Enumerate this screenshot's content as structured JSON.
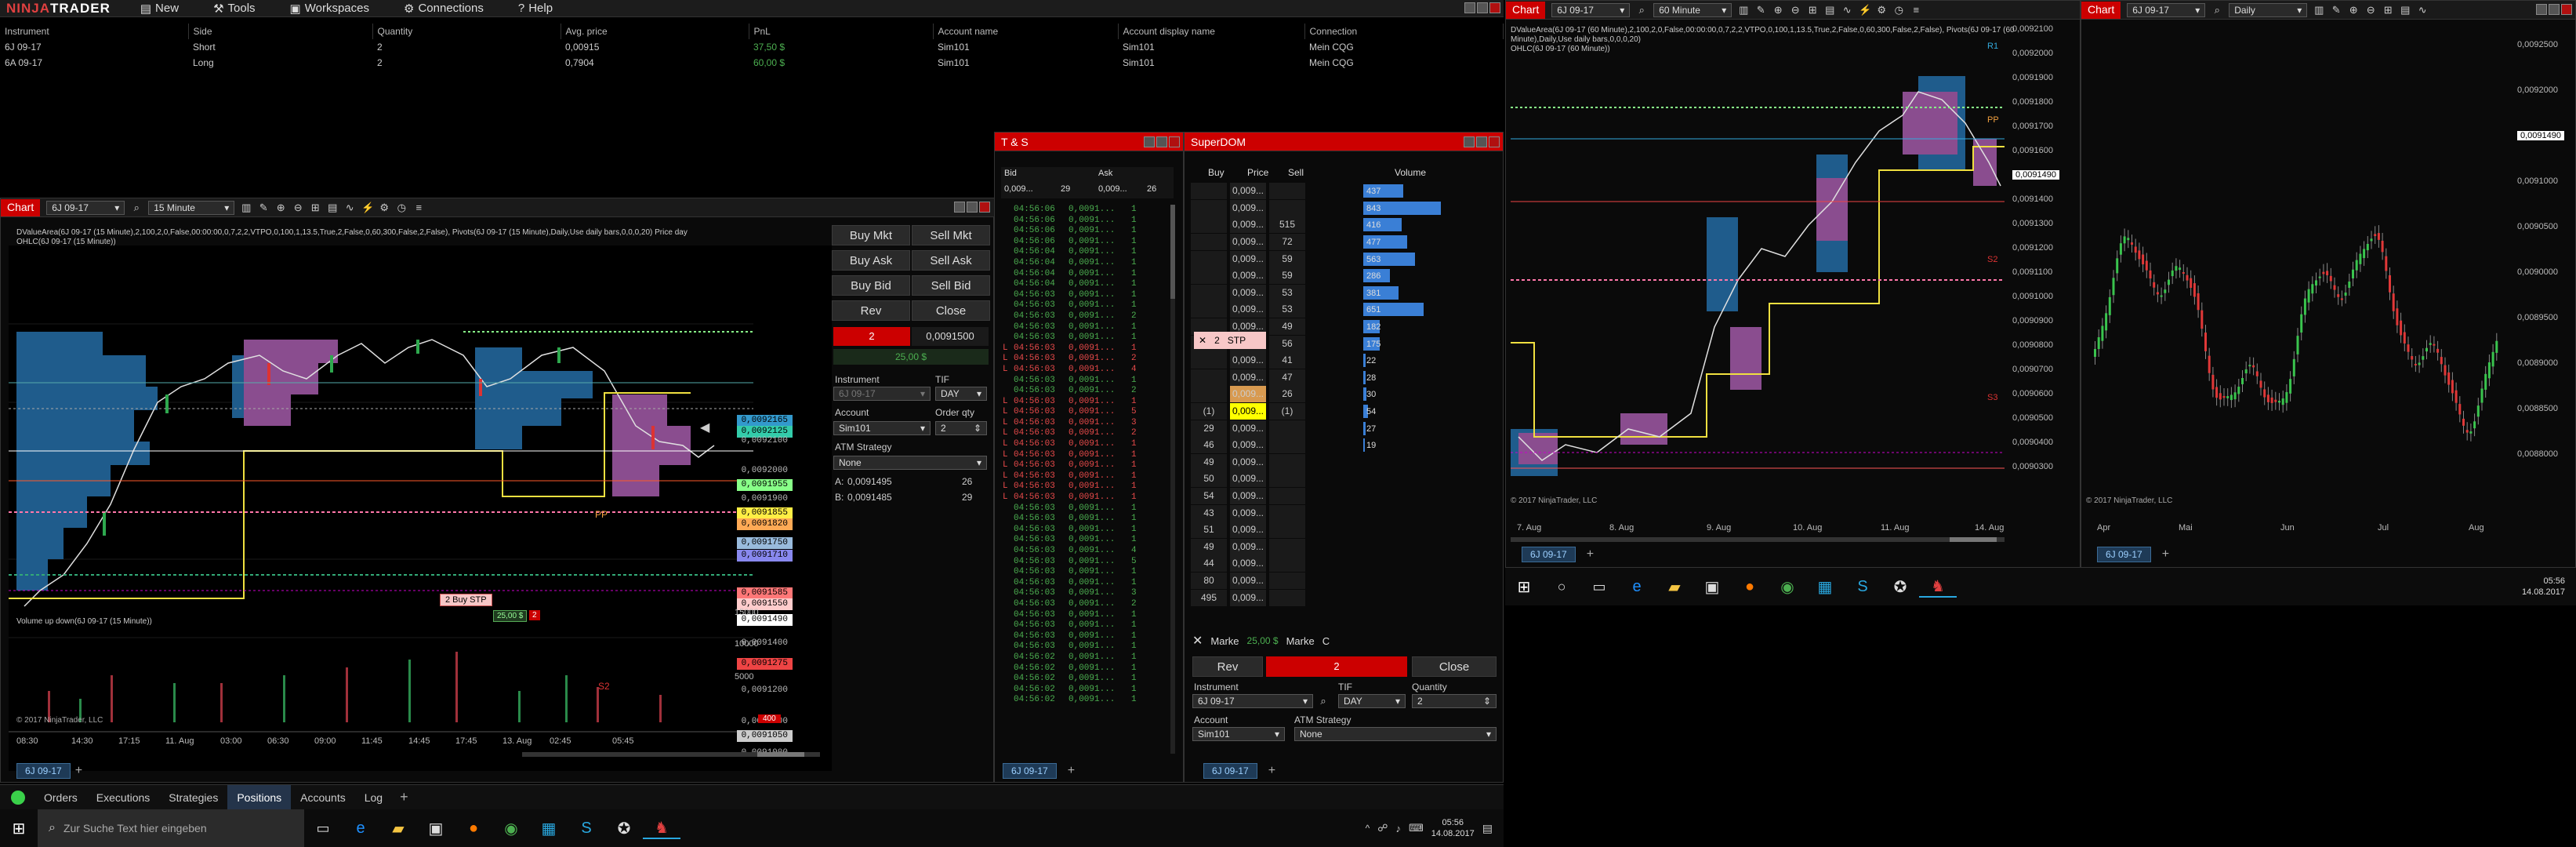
{
  "app": {
    "logo_part1": "NINJA",
    "logo_part2": "TRADER",
    "menu": [
      "New",
      "Tools",
      "Workspaces",
      "Connections",
      "Help"
    ]
  },
  "positions": {
    "headers": [
      "Instrument",
      "Side",
      "Quantity",
      "Avg. price",
      "PnL",
      "Account name",
      "Account display name",
      "Connection"
    ],
    "rows": [
      [
        "6J 09-17",
        "Short",
        "2",
        "0,00915",
        "37,50 $",
        "Sim101",
        "Sim101",
        "Mein CQG"
      ],
      [
        "6A 09-17",
        "Long",
        "2",
        "0,7904",
        "60,00 $",
        "Sim101",
        "Sim101",
        "Mein CQG"
      ]
    ]
  },
  "chart1": {
    "tab": "Chart",
    "instrument": "6J 09-17",
    "interval": "15 Minute",
    "info": "DValueArea(6J 09-17 (15 Minute),2,100,2,0,False,00:00:00,0,7,2,2,VTPO,0,100,1,13.5,True,2,False,0,60,300,False,2,False), Pivots(6J 09-17 (15 Minute),Daily,Use daily bars,0,0,0,20) Price day",
    "ohlc": "OHLC(6J 09-17 (15 Minute))",
    "price_labels": [
      "0,0092165",
      "0,0092125",
      "0,0092100",
      "0,0092000",
      "0,0091955",
      "0,0091900",
      "0,0091855",
      "0,0091820",
      "0,0091750",
      "0,0091710",
      "0,0091585",
      "0,0091550",
      "0,0091490",
      "0,0091400",
      "0,0091275",
      "0,0091200",
      "0,0091100",
      "0,0091050",
      "0,0091000"
    ],
    "order_label": "2  Buy STP",
    "order_price": "25,00 $",
    "order_qty": "2",
    "pp": "PP",
    "s2": "S2",
    "volume_title": "Volume up down(6J 09-17 (15 Minute))",
    "volume_axis": [
      "15000",
      "10000",
      "5000",
      "400"
    ],
    "copyright": "© 2017 NinjaTrader, LLC",
    "x_labels": [
      "08:30",
      "14:30",
      "17:15",
      "11. Aug",
      "03:00",
      "06:30",
      "09:00",
      "11:45",
      "14:45",
      "17:45",
      "13. Aug",
      "02:45",
      "05:45"
    ],
    "bottom_tab": "6J 09-17"
  },
  "chart_trader": {
    "buy_mkt": "Buy Mkt",
    "sell_mkt": "Sell Mkt",
    "buy_ask": "Buy Ask",
    "sell_ask": "Sell Ask",
    "buy_bid": "Buy Bid",
    "sell_bid": "Sell Bid",
    "rev": "Rev",
    "close": "Close",
    "position_qty": "2",
    "position_price": "0,0091500",
    "pnl": "25,00 $",
    "instrument_label": "Instrument",
    "instrument": "6J 09-17",
    "tif_label": "TIF",
    "tif": "DAY",
    "account_label": "Account",
    "account": "Sim101",
    "qty_label": "Order qty",
    "qty": "2",
    "atm_label": "ATM Strategy",
    "atm": "None",
    "ask_label": "A:",
    "ask": "0,0091495",
    "ask_size": "26",
    "bid_label": "B:",
    "bid": "0,0091485",
    "bid_size": "29"
  },
  "ts": {
    "title": "T & S",
    "bid_head": "Bid",
    "ask_head": "Ask",
    "bid_val": "0,009...",
    "bid_size": "29",
    "ask_val": "0,009...",
    "ask_size": "26",
    "bottom_tab": "6J 09-17",
    "rows": [
      [
        "g",
        "04:56:06",
        "0,0091...",
        "1"
      ],
      [
        "g",
        "04:56:06",
        "0,0091...",
        "1"
      ],
      [
        "g",
        "04:56:06",
        "0,0091...",
        "1"
      ],
      [
        "g",
        "04:56:06",
        "0,0091...",
        "1"
      ],
      [
        "g",
        "04:56:04",
        "0,0091...",
        "1"
      ],
      [
        "g",
        "04:56:04",
        "0,0091...",
        "1"
      ],
      [
        "g",
        "04:56:04",
        "0,0091...",
        "1"
      ],
      [
        "g",
        "04:56:04",
        "0,0091...",
        "1"
      ],
      [
        "g",
        "04:56:03",
        "0,0091...",
        "1"
      ],
      [
        "g",
        "04:56:03",
        "0,0091...",
        "1"
      ],
      [
        "g",
        "04:56:03",
        "0,0091...",
        "2"
      ],
      [
        "g",
        "04:56:03",
        "0,0091...",
        "1"
      ],
      [
        "g",
        "04:56:03",
        "0,0091...",
        "1"
      ],
      [
        "r",
        "04:56:03",
        "0,0091...",
        "1"
      ],
      [
        "r",
        "04:56:03",
        "0,0091...",
        "2"
      ],
      [
        "r",
        "04:56:03",
        "0,0091...",
        "4"
      ],
      [
        "g",
        "04:56:03",
        "0,0091...",
        "1"
      ],
      [
        "g",
        "04:56:03",
        "0,0091...",
        "2"
      ],
      [
        "r",
        "04:56:03",
        "0,0091...",
        "1"
      ],
      [
        "r",
        "04:56:03",
        "0,0091...",
        "5"
      ],
      [
        "r",
        "04:56:03",
        "0,0091...",
        "3"
      ],
      [
        "r",
        "04:56:03",
        "0,0091...",
        "2"
      ],
      [
        "r",
        "04:56:03",
        "0,0091...",
        "1"
      ],
      [
        "r",
        "04:56:03",
        "0,0091...",
        "1"
      ],
      [
        "r",
        "04:56:03",
        "0,0091...",
        "1"
      ],
      [
        "r",
        "04:56:03",
        "0,0091...",
        "1"
      ],
      [
        "r",
        "04:56:03",
        "0,0091...",
        "1"
      ],
      [
        "r",
        "04:56:03",
        "0,0091...",
        "1"
      ],
      [
        "g",
        "04:56:03",
        "0,0091...",
        "1"
      ],
      [
        "g",
        "04:56:03",
        "0,0091...",
        "1"
      ],
      [
        "g",
        "04:56:03",
        "0,0091...",
        "1"
      ],
      [
        "g",
        "04:56:03",
        "0,0091...",
        "1"
      ],
      [
        "g",
        "04:56:03",
        "0,0091...",
        "4"
      ],
      [
        "g",
        "04:56:03",
        "0,0091...",
        "5"
      ],
      [
        "g",
        "04:56:03",
        "0,0091...",
        "1"
      ],
      [
        "g",
        "04:56:03",
        "0,0091...",
        "1"
      ],
      [
        "g",
        "04:56:03",
        "0,0091...",
        "3"
      ],
      [
        "g",
        "04:56:03",
        "0,0091...",
        "2"
      ],
      [
        "g",
        "04:56:03",
        "0,0091...",
        "1"
      ],
      [
        "g",
        "04:56:03",
        "0,0091...",
        "1"
      ],
      [
        "g",
        "04:56:03",
        "0,0091...",
        "1"
      ],
      [
        "g",
        "04:56:03",
        "0,0091...",
        "1"
      ],
      [
        "g",
        "04:56:02",
        "0,0091...",
        "1"
      ],
      [
        "g",
        "04:56:02",
        "0,0091...",
        "1"
      ],
      [
        "g",
        "04:56:02",
        "0,0091...",
        "1"
      ],
      [
        "g",
        "04:56:02",
        "0,0091...",
        "1"
      ],
      [
        "g",
        "04:56:02",
        "0,0091...",
        "1"
      ]
    ]
  },
  "superdom": {
    "title": "SuperDOM",
    "h_buy": "Buy",
    "h_price": "Price",
    "h_sell": "Sell",
    "h_volume": "Volume",
    "stp_qty": "2",
    "stp_label": "STP",
    "rows": [
      [
        "",
        "0,009...",
        "",
        "437"
      ],
      [
        "",
        "0,009...",
        "",
        "843"
      ],
      [
        "",
        "0,009...",
        "515",
        "416"
      ],
      [
        "",
        "0,009...",
        "72",
        "477"
      ],
      [
        "",
        "0,009...",
        "59",
        "563"
      ],
      [
        "",
        "0,009...",
        "59",
        "286"
      ],
      [
        "",
        "0,009...",
        "53",
        "381"
      ],
      [
        "",
        "0,009...",
        "53",
        "651"
      ],
      [
        "",
        "0,009...",
        "49",
        "182"
      ],
      [
        "",
        "0,009...",
        "56",
        "175"
      ],
      [
        "",
        "0,009...",
        "41",
        "22"
      ],
      [
        "",
        "0,009...",
        "47",
        "28"
      ],
      [
        "",
        "0,009...",
        "26",
        "30"
      ],
      [
        "(1)",
        "0,009...",
        "(1)",
        "54"
      ],
      [
        "29",
        "0,009...",
        "",
        "27"
      ],
      [
        "46",
        "0,009...",
        "",
        "19"
      ],
      [
        "49",
        "0,009...",
        "",
        ""
      ],
      [
        "50",
        "0,009...",
        "",
        ""
      ],
      [
        "54",
        "0,009...",
        "",
        ""
      ],
      [
        "43",
        "0,009...",
        "",
        ""
      ],
      [
        "51",
        "0,009...",
        "",
        ""
      ],
      [
        "49",
        "0,009...",
        "",
        ""
      ],
      [
        "44",
        "0,009...",
        "",
        ""
      ],
      [
        "80",
        "0,009...",
        "",
        ""
      ],
      [
        "495",
        "0,009...",
        "",
        ""
      ]
    ],
    "market_buy": "Marke",
    "pnl": "25,00 $",
    "market_sell": "Marke",
    "c": "C",
    "rev": "Rev",
    "qty": "2",
    "close": "Close",
    "instrument_label": "Instrument",
    "instrument": "6J 09-17",
    "tif_label": "TIF",
    "tif": "DAY",
    "quantity_label": "Quantity",
    "quantity": "2",
    "account_label": "Account",
    "account": "Sim101",
    "atm_label": "ATM Strategy",
    "atm": "None",
    "bottom_tab": "6J 09-17"
  },
  "chart2": {
    "tab": "Chart",
    "instrument": "6J 09-17",
    "interval": "60 Minute",
    "info": "DValueArea(6J 09-17 (60 Minute),2,100,2,0,False,00:00:00,0,7,2,2,VTPO,0,100,1,13.5,True,2,False,0,60,300,False,2,False), Pivots(6J 09-17 (60 Minute),Daily,Use daily bars,0,0,0,20)",
    "ohlc": "OHLC(6J 09-17 (60 Minute))",
    "price_labels": [
      "0,0092100",
      "0,0092000",
      "0,0091900",
      "0,0091800",
      "0,0091700",
      "0,0091600",
      "0,0091490",
      "0,0091400",
      "0,0091300",
      "0,0091200",
      "0,0091100",
      "0,0091000",
      "0,0090900",
      "0,0090800",
      "0,0090700",
      "0,0090600",
      "0,0090500",
      "0,0090400",
      "0,0090300"
    ],
    "r1": "R1",
    "pp": "PP",
    "s2": "S2",
    "s3": "S3",
    "x_labels": [
      "7. Aug",
      "8. Aug",
      "9. Aug",
      "10. Aug",
      "11. Aug",
      "14. Aug"
    ],
    "copyright": "© 2017 NinjaTrader, LLC",
    "bottom_tab": "6J 09-17"
  },
  "chart3": {
    "tab": "Chart",
    "instrument": "6J 09-17",
    "interval": "Daily",
    "price_labels": [
      "0,0092500",
      "0,0092000",
      "0,0091490",
      "0,0091000",
      "0,0090500",
      "0,0090000",
      "0,0089500",
      "0,0089000",
      "0,0088500",
      "0,0088000"
    ],
    "x_labels": [
      "Apr",
      "Mai",
      "Jun",
      "Jul",
      "Aug"
    ],
    "copyright": "© 2017 NinjaTrader, LLC",
    "bottom_tab": "6J 09-17"
  },
  "bottom_tabs": [
    "Orders",
    "Executions",
    "Strategies",
    "Positions",
    "Accounts",
    "Log"
  ],
  "taskbar_left": {
    "search": "Zur Suche Text hier eingeben",
    "time": "05:56",
    "date": "14.08.2017"
  },
  "taskbar_right": {
    "time": "05:56",
    "date": "14.08.2017"
  }
}
